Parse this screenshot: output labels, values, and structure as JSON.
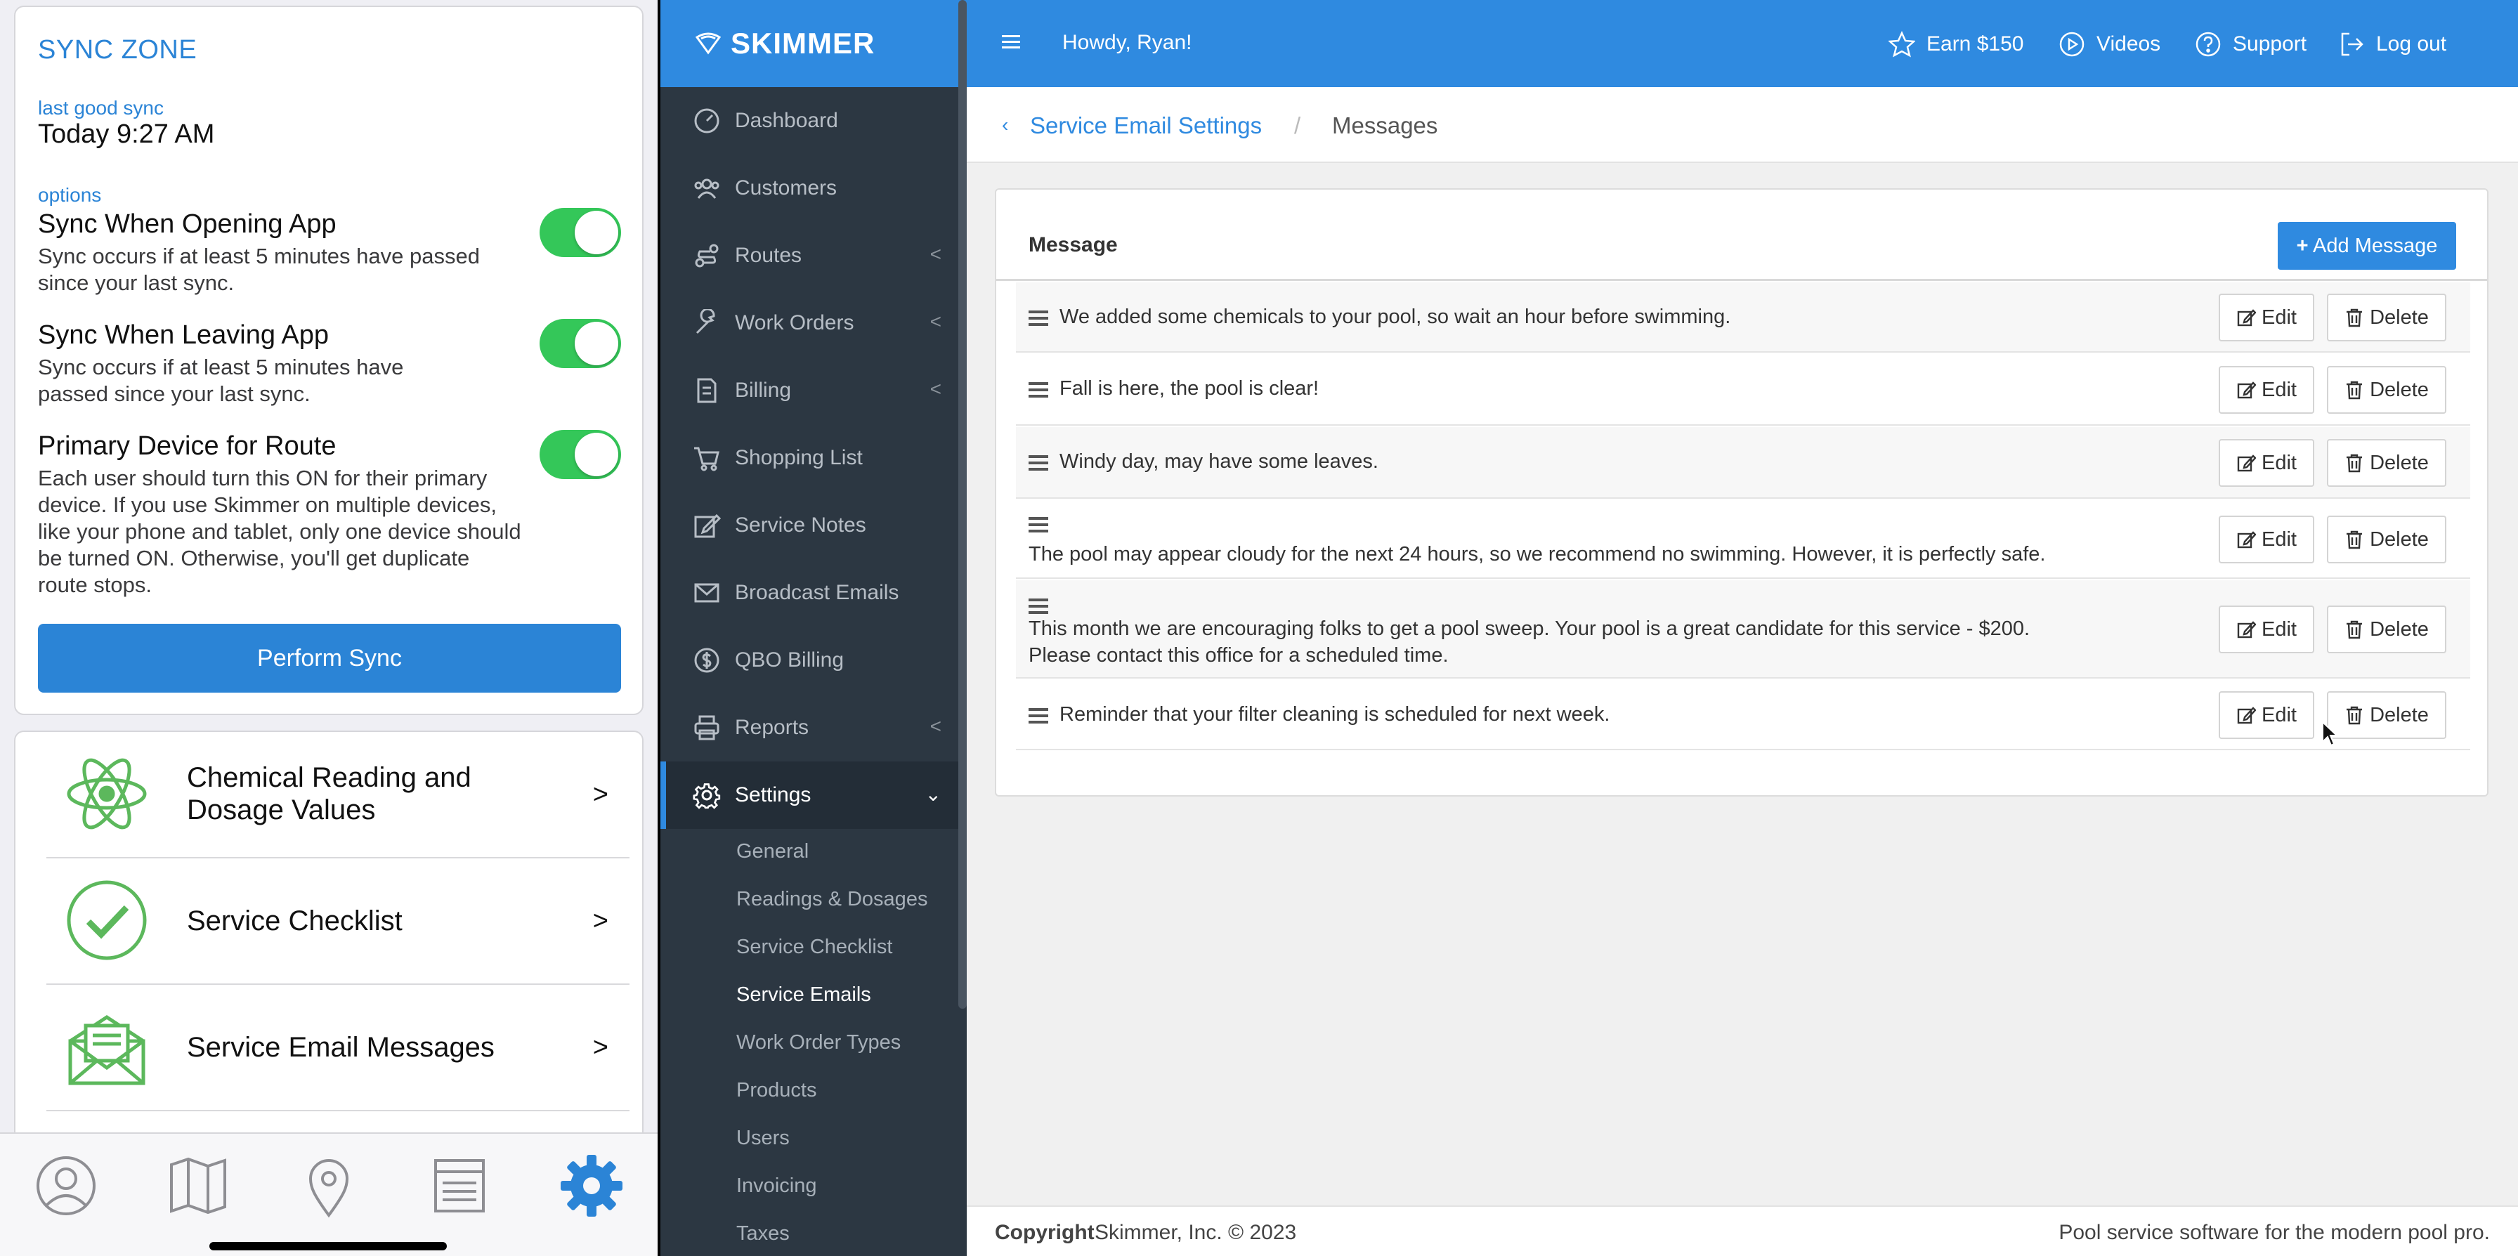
{
  "mobile": {
    "sync_zone": {
      "title": "SYNC ZONE",
      "last_sync_label": "last good sync",
      "last_sync_value": "Today 9:27 AM",
      "options_label": "options",
      "options": [
        {
          "title": "Sync When Opening App",
          "desc": "Sync occurs if at least 5 minutes have passed since your last sync.",
          "enabled": true
        },
        {
          "title": "Sync When Leaving App",
          "desc": "Sync occurs if at least 5 minutes have passed since your last sync.",
          "enabled": true
        },
        {
          "title": "Primary Device for Route",
          "desc": "Each user should turn this ON for their primary device. If you use Skimmer on multiple devices, like your phone and tablet, only one device should be turned ON. Otherwise, you'll get duplicate route stops.",
          "enabled": true
        }
      ],
      "button_label": "Perform Sync"
    },
    "menu": [
      {
        "label": "Chemical Reading and Dosage Values",
        "icon": "atom-icon"
      },
      {
        "label": "Service Checklist",
        "icon": "checkmark-circle-icon"
      },
      {
        "label": "Service Email Messages",
        "icon": "envelope-letter-icon"
      }
    ],
    "chevron": ">",
    "tabs": [
      "profile-icon",
      "map-icon",
      "location-pin-icon",
      "list-icon",
      "settings-gear-icon"
    ],
    "colors": {
      "accent": "#2b84d6",
      "toggle_on": "#34c759"
    }
  },
  "web": {
    "logo": "SKIMMER",
    "topbar": {
      "greeting": "Howdy, Ryan!",
      "earn": "Earn $150",
      "videos": "Videos",
      "support": "Support",
      "logout": "Log out"
    },
    "sidebar": {
      "items": [
        {
          "label": "Dashboard",
          "icon": "dashboard-icon"
        },
        {
          "label": "Customers",
          "icon": "users-icon"
        },
        {
          "label": "Routes",
          "icon": "route-icon",
          "arrow": "<"
        },
        {
          "label": "Work Orders",
          "icon": "wrench-icon",
          "arrow": "<"
        },
        {
          "label": "Billing",
          "icon": "invoice-icon",
          "arrow": "<"
        },
        {
          "label": "Shopping List",
          "icon": "cart-icon"
        },
        {
          "label": "Service Notes",
          "icon": "edit-icon"
        },
        {
          "label": "Broadcast Emails",
          "icon": "envelope-icon"
        },
        {
          "label": "QBO Billing",
          "icon": "dollar-circle-icon"
        },
        {
          "label": "Reports",
          "icon": "printer-icon",
          "arrow": "<"
        },
        {
          "label": "Settings",
          "icon": "gear-icon",
          "arrow": "⌄"
        }
      ],
      "settings_sub": [
        "General",
        "Readings & Dosages",
        "Service Checklist",
        "Service Emails",
        "Work Order Types",
        "Products",
        "Users",
        "Invoicing",
        "Taxes"
      ],
      "active_sub": "Service Emails"
    },
    "breadcrumb": {
      "parent": "Service Email Settings",
      "separator": "/",
      "current": "Messages"
    },
    "table": {
      "header": "Message",
      "add_button": "Add Message",
      "edit_label": "Edit",
      "delete_label": "Delete",
      "rows": [
        "We added some chemicals to your pool, so wait an hour before swimming.",
        "Fall is here, the pool is clear!",
        "Windy day, may have some leaves.",
        "The pool may appear cloudy for the next 24 hours, so we recommend no swimming. However, it is perfectly safe.",
        "This month we are encouraging folks to get a pool sweep. Your pool is a great candidate for this service - $200.",
        "Please contact this office for a scheduled time.",
        "Reminder that your filter cleaning is scheduled for next week."
      ]
    },
    "footer": {
      "copyright_label": "Copyright",
      "copyright_text": "Skimmer, Inc. © 2023",
      "tagline": "Pool service software for the modern pool pro."
    },
    "colors": {
      "brand": "#2f8ae0",
      "sidebar": "#2c3742"
    }
  }
}
